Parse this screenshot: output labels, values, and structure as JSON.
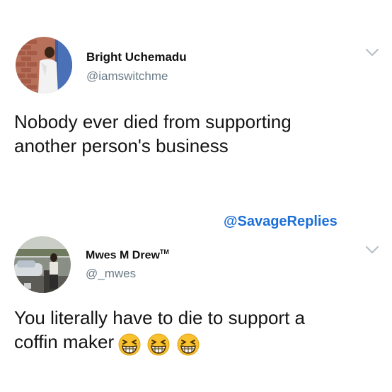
{
  "tweets": [
    {
      "author_name": "Bright Uchemadu",
      "author_handle": "@iamswitchme",
      "text_line1": "Nobody ever died from supporting",
      "text_line2": "another person's business"
    },
    {
      "author_name": "Mwes M Drew",
      "author_name_badge": "TM",
      "author_handle": "@_mwes",
      "text_line1": "You literally have to die to support a",
      "text_line2": "coffin maker",
      "emojis": [
        "grinning-squinting-face",
        "grinning-squinting-face",
        "grinning-squinting-face"
      ]
    }
  ],
  "watermark": "@SavageReplies",
  "colors": {
    "handle": "#6b7b86",
    "watermark": "#1b6fd8",
    "chevron": "#b8c0c6"
  },
  "icons": {
    "menu": "chevron-down-icon"
  }
}
